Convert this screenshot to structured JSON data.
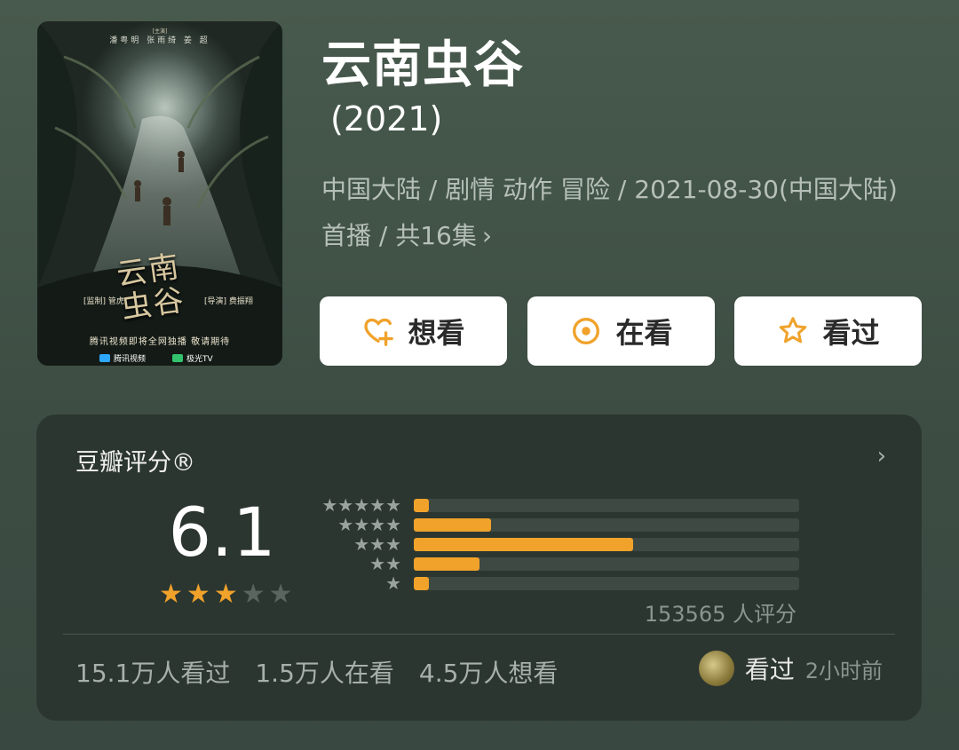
{
  "poster": {
    "credits": "潘粤明  张雨绮  姜  超",
    "credits_sub": "[主演]",
    "logo_line1": "云南",
    "logo_line2": "虫谷",
    "role_left": "[监制] 管虎",
    "role_right": "[导演] 费振翔",
    "tagline": "腾讯视频即将全网独播  敬请期待",
    "platform1": "腾讯视频",
    "platform2": "极光TV"
  },
  "show": {
    "title": "云南虫谷",
    "year": "(2021)",
    "meta": "中国大陆 / 剧情 动作 冒险 / 2021-08-30(中国大陆) 首播 / 共16集",
    "meta_chevron": "›"
  },
  "actions": {
    "want": "想看",
    "watching": "在看",
    "watched": "看过"
  },
  "rating": {
    "title": "豆瓣评分®",
    "chevron": "›",
    "score": "6.1",
    "stars_filled": 3,
    "stars_total": 5,
    "distribution": [
      {
        "stars": 5,
        "percent": 4
      },
      {
        "stars": 4,
        "percent": 20
      },
      {
        "stars": 3,
        "percent": 57
      },
      {
        "stars": 2,
        "percent": 17
      },
      {
        "stars": 1,
        "percent": 4
      }
    ],
    "raters": "153565 人评分"
  },
  "stats": {
    "watched": "15.1万人看过",
    "watching": "1.5万人在看",
    "want": "4.5万人想看"
  },
  "friend": {
    "status": "看过",
    "time": "2小时前"
  },
  "colors": {
    "accent": "#f0a22b",
    "card_bg": "#2c3630",
    "page_bg": "#455549"
  }
}
